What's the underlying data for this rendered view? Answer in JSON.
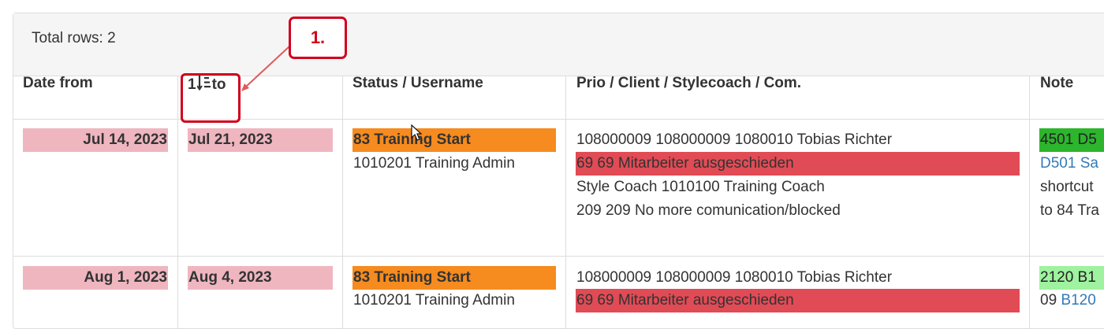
{
  "summary": {
    "total_rows": "Total rows: 2"
  },
  "columns": {
    "date_from": "Date from",
    "to_prefix": "1",
    "to_label": "to",
    "status": "Status / Username",
    "prio": "Prio / Client / Stylecoach / Com.",
    "note": "Note"
  },
  "annotation": {
    "callout": "1."
  },
  "rows": [
    {
      "date_from": "Jul 14, 2023",
      "date_to": "Jul 21, 2023",
      "status": "83 Training Start",
      "username": "1010201 Training Admin",
      "prio_client": "108000009 108000009 1080010 Tobias Richter",
      "reason": "69 69 Mitarbeiter ausgeschieden",
      "stylecoach": "Style Coach 1010100 Training Coach",
      "comm": "209 209 No more comunication/blocked",
      "note_tag": "4501 D5",
      "note_link": "D501 Sa",
      "note_line3": "shortcut",
      "note_line4": "to 84 Tra"
    },
    {
      "date_from": "Aug 1, 2023",
      "date_to": "Aug 4, 2023",
      "status": "83 Training Start",
      "username": "1010201 Training Admin",
      "prio_client": "108000009 108000009 1080010 Tobias Richter",
      "reason": "69 69 Mitarbeiter ausgeschieden",
      "note_tag": "2120 B1",
      "note_prefix": "09",
      "note_link": "B120"
    }
  ],
  "colors": {
    "date_bg": "#efb6c0",
    "status_bg": "#f68b1f",
    "reason_bg": "#e14b55",
    "note_dark_green": "#2db52d",
    "note_light_green": "#9ff29f",
    "callout_red": "#d0021b",
    "link": "#337ab7"
  },
  "icons": [
    "sort-numeric-icon",
    "mouse-cursor-icon",
    "callout-arrow-icon"
  ]
}
